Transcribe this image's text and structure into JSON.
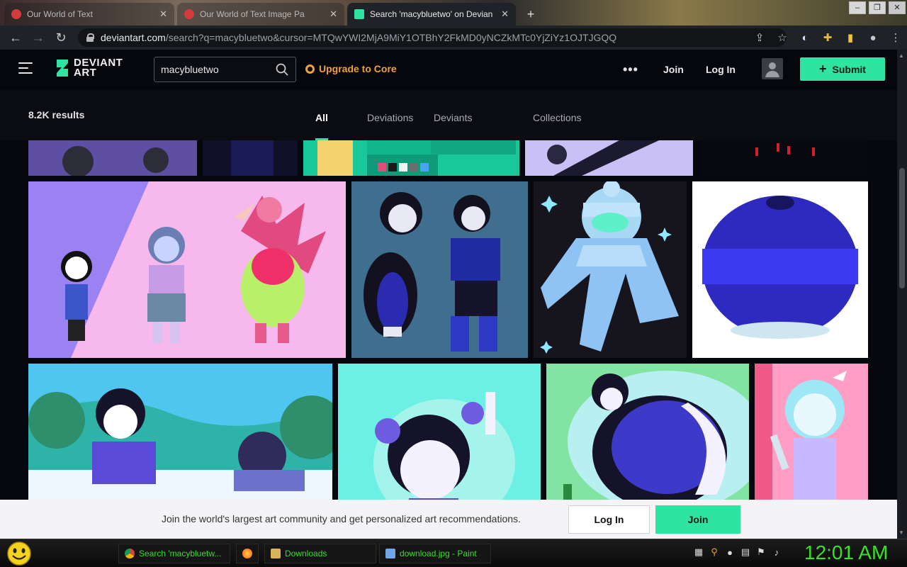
{
  "browser": {
    "tabs": [
      {
        "title": "Our World of Text",
        "favicon_color": "#d43b3b",
        "active": false
      },
      {
        "title": "Our World of Text Image Pa",
        "favicon_color": "#d43b3b",
        "active": false
      },
      {
        "title": "Search 'macybluetwo' on Devian",
        "favicon_color": "#2fe3a0",
        "active": true
      }
    ],
    "url_host": "deviantart.com",
    "url_rest": "/search?q=macybluetwo&cursor=MTQwYWI2MjA9MiY1OTBhY2FkMD0yNCZkMTc0YjZiYz1OJTJGQQ",
    "nav": {
      "back_icon": "arrow-left-icon",
      "forward_icon": "arrow-right-icon",
      "reload_icon": "reload-icon"
    }
  },
  "header": {
    "logo_line1": "DEVIANT",
    "logo_line2": "ART",
    "search_value": "macybluetwo",
    "upgrade_label": "Upgrade to Core",
    "more_label": "•••",
    "join_label": "Join",
    "login_label": "Log In",
    "submit_label": "Submit",
    "accent_color": "#2fe3a0"
  },
  "results": {
    "count_label": "8.2K results",
    "tabs": [
      "All",
      "Deviations",
      "Deviants",
      "Collections"
    ],
    "active_tab": "All"
  },
  "banner": {
    "text": "Join the world's largest art community and get personalized art recommendations.",
    "login_label": "Log In",
    "join_label": "Join"
  },
  "taskbar": {
    "items": [
      {
        "label": "Search 'macybluetw..."
      },
      {
        "label": ""
      },
      {
        "label": "Downloads"
      },
      {
        "label": "download.jpg - Paint"
      }
    ],
    "clock": "12:01 AM"
  }
}
